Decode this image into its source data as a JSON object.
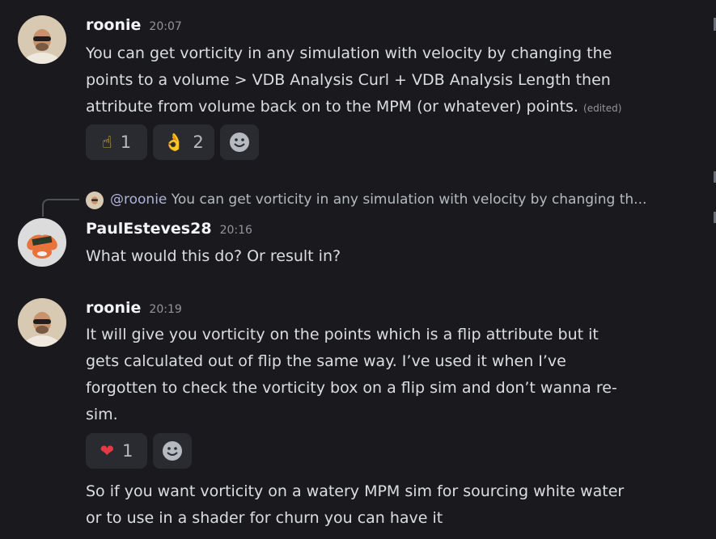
{
  "messages": [
    {
      "author": "roonie",
      "time": "20:07",
      "lines": [
        "You can get vorticity in any simulation with velocity by changing the",
        "points to a volume > VDB Analysis Curl + VDB Analysis Length then",
        "attribute from volume back on to the MPM (or whatever) points."
      ],
      "edited": "(edited)",
      "reactions": [
        {
          "emoji": "☝",
          "count": "1"
        },
        {
          "emoji": "👌",
          "count": "2"
        }
      ]
    },
    {
      "reply": {
        "mention": "@roonie",
        "snippet": "You can get vorticity in any simulation with velocity by changing th..."
      },
      "author": "PaulEsteves28",
      "time": "20:16",
      "lines": [
        "What would this do? Or result in?"
      ]
    },
    {
      "author": "roonie",
      "time": "20:19",
      "lines": [
        "It will give you vorticity on the points which is a flip attribute but it",
        "gets calculated out of flip the same way. I’ve used it when I’ve",
        "forgotten to check the vorticity box on a flip sim and don’t wanna re-",
        "sim."
      ],
      "reactions": [
        {
          "emoji": "❤",
          "count": "1"
        }
      ],
      "followup_lines": [
        "So if you want vorticity on a watery MPM sim for sourcing white water",
        "or to use in a shader for churn you can have it"
      ]
    }
  ],
  "colors": {
    "background": "#1a1a1e",
    "reaction_bg": "#2a2b30",
    "author": "#f2f3f5",
    "heart": "#e53945"
  }
}
